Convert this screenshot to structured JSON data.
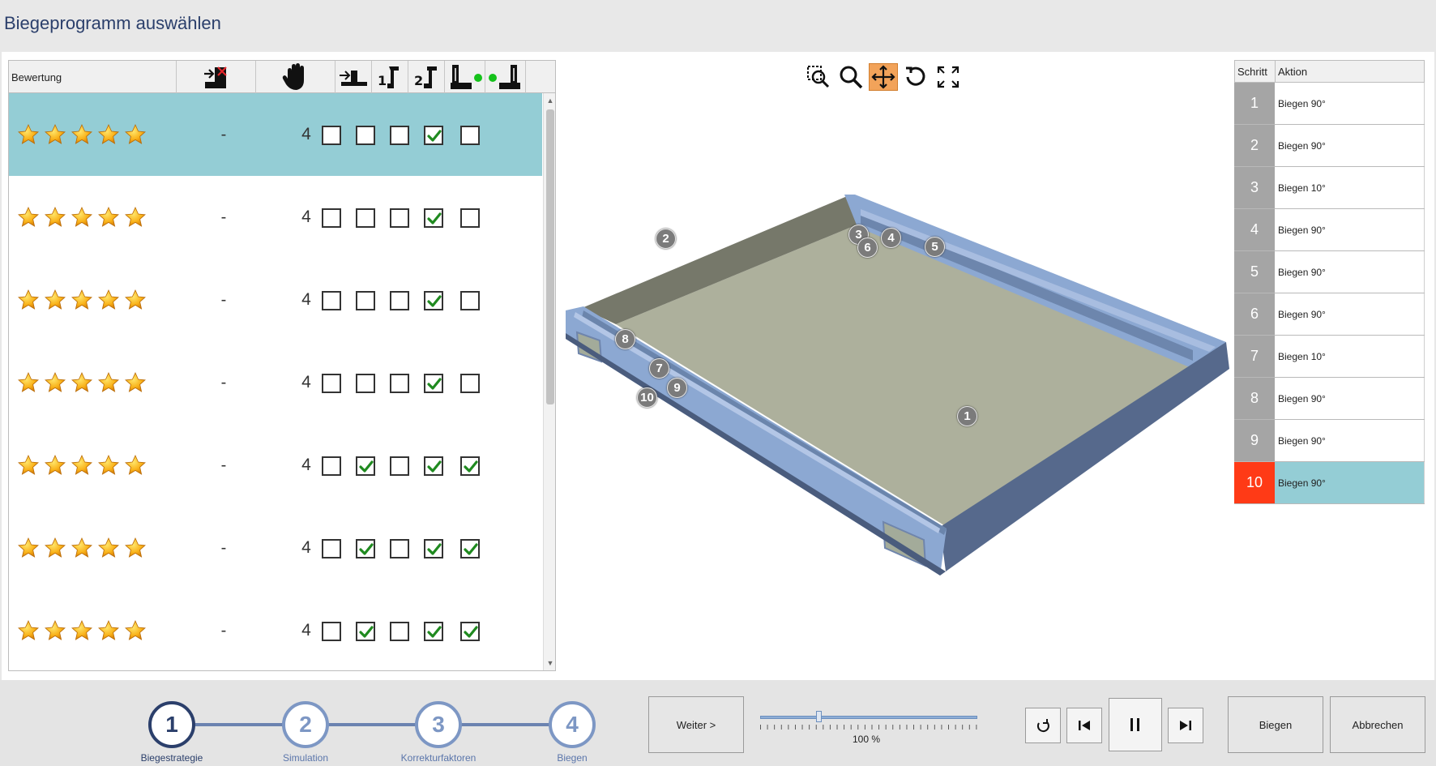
{
  "window": {
    "title": "Biegeprogramm auswählen"
  },
  "table": {
    "header": {
      "rating_label": "Bewertung",
      "columns": [
        {
          "icon": "alignment-stop-icon"
        },
        {
          "icon": "hand-icon"
        },
        {
          "icon": "push-in-icon"
        },
        {
          "icon": "gripper-1-icon"
        },
        {
          "icon": "gripper-2-icon"
        },
        {
          "icon": "clamp-green-dot-icon"
        },
        {
          "icon": "clamp-dot-left-icon"
        }
      ]
    },
    "rows": [
      {
        "stars": 5,
        "dash": "-",
        "count": "4",
        "checks": [
          false,
          false,
          false,
          true,
          false
        ],
        "selected": true
      },
      {
        "stars": 5,
        "dash": "-",
        "count": "4",
        "checks": [
          false,
          false,
          false,
          true,
          false
        ],
        "selected": false
      },
      {
        "stars": 5,
        "dash": "-",
        "count": "4",
        "checks": [
          false,
          false,
          false,
          true,
          false
        ],
        "selected": false
      },
      {
        "stars": 5,
        "dash": "-",
        "count": "4",
        "checks": [
          false,
          false,
          false,
          true,
          false
        ],
        "selected": false
      },
      {
        "stars": 5,
        "dash": "-",
        "count": "4",
        "checks": [
          false,
          true,
          false,
          true,
          true
        ],
        "selected": false
      },
      {
        "stars": 5,
        "dash": "-",
        "count": "4",
        "checks": [
          false,
          true,
          false,
          true,
          true
        ],
        "selected": false
      },
      {
        "stars": 5,
        "dash": "-",
        "count": "4",
        "checks": [
          false,
          true,
          false,
          true,
          true
        ],
        "selected": false
      }
    ]
  },
  "viewer": {
    "tools": [
      "zoom-window-icon",
      "zoom-icon",
      "pan-icon",
      "rotate-icon",
      "fit-view-icon"
    ],
    "active_tool": "pan-icon",
    "markers": [
      "1",
      "2",
      "3",
      "4",
      "5",
      "6",
      "7",
      "8",
      "9",
      "10"
    ]
  },
  "steps": {
    "header_step": "Schritt",
    "header_action": "Aktion",
    "items": [
      {
        "n": "1",
        "action": "Biegen 90°"
      },
      {
        "n": "2",
        "action": "Biegen 90°"
      },
      {
        "n": "3",
        "action": "Biegen 10°"
      },
      {
        "n": "4",
        "action": "Biegen 90°"
      },
      {
        "n": "5",
        "action": "Biegen 90°"
      },
      {
        "n": "6",
        "action": "Biegen 90°"
      },
      {
        "n": "7",
        "action": "Biegen 10°"
      },
      {
        "n": "8",
        "action": "Biegen 90°"
      },
      {
        "n": "9",
        "action": "Biegen 90°"
      },
      {
        "n": "10",
        "action": "Biegen 90°"
      }
    ],
    "active_index": 9
  },
  "wizard": {
    "steps": [
      {
        "n": "1",
        "label": "Biegestrategie"
      },
      {
        "n": "2",
        "label": "Simulation"
      },
      {
        "n": "3",
        "label": "Korrekturfaktoren"
      },
      {
        "n": "4",
        "label": "Biegen"
      }
    ],
    "current": 0
  },
  "footer": {
    "next_label": "Weiter >",
    "speed_value": "100 %",
    "speed_fraction": 0.27,
    "bend_label": "Biegen",
    "cancel_label": "Abbrechen"
  },
  "colors": {
    "selected_row": "#94cdd5",
    "active_step_number": "#ff3a16",
    "active_tool": "#f2a35a",
    "part_blue": "#8caad6",
    "part_floor": "#adb09c",
    "wizard_current": "#2b3f6b",
    "wizard_other": "#7d97c4"
  }
}
